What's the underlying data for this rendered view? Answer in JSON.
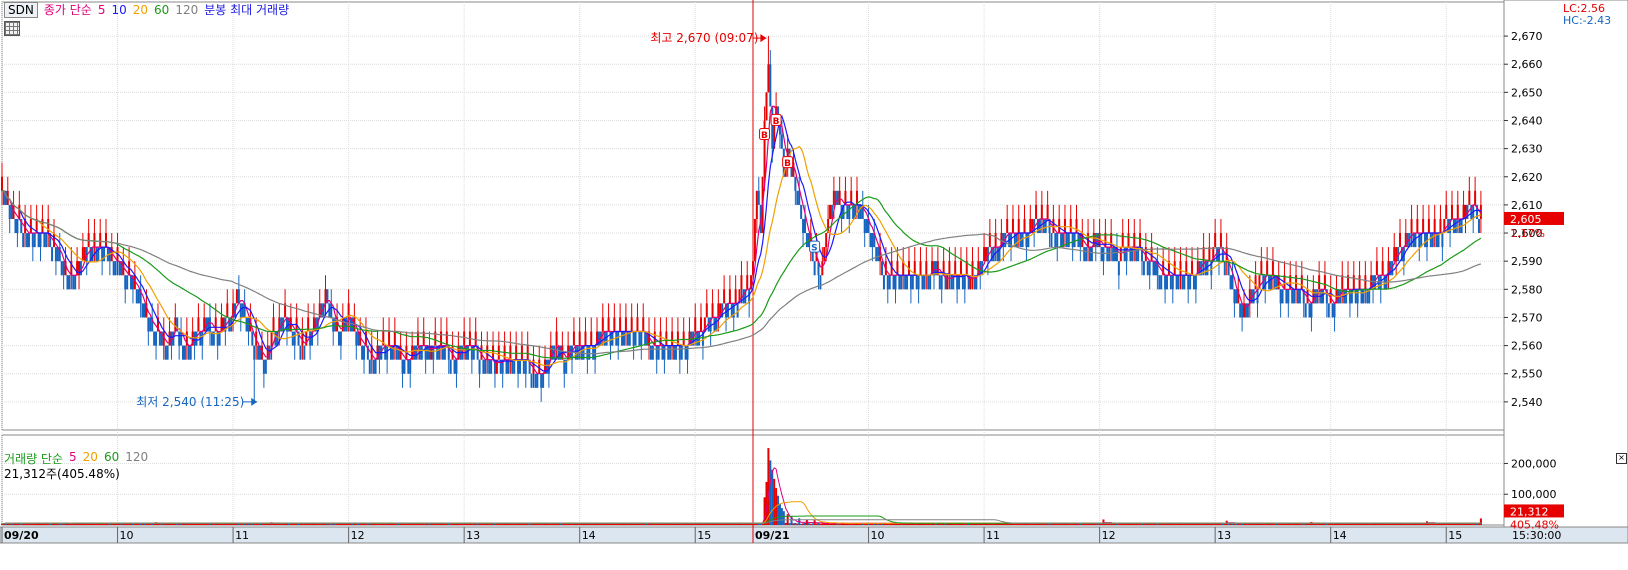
{
  "symbol": "SDN",
  "price_legend": {
    "label": "종가 단순",
    "periods": [
      "5",
      "10",
      "20",
      "60",
      "120"
    ],
    "extra": "분봉 최대 거래량"
  },
  "volume_legend": {
    "label": "거래량 단순",
    "periods": [
      "5",
      "20",
      "60",
      "120"
    ]
  },
  "volume_current": "21,312주(405.48%)",
  "lc_label": "LC:2.56",
  "hc_label": "HC:-2.43",
  "last_price_label": "2,605",
  "last_pct_label": "1.17%",
  "last_vol_label": "21,312",
  "last_vol_pct_label": "405.48%",
  "high_annotation": "최고 2,670 (09:07)",
  "low_annotation": "최저 2,540 (11:25)",
  "time_right_label": "15:30:00",
  "colors": {
    "up": "#e60000",
    "down": "#1565c0",
    "ma5": "#e0007a",
    "ma10": "#1a1aff",
    "ma20": "#f0a000",
    "ma60": "#1a9a1a",
    "ma120": "#808080",
    "grid": "#dcdcdc",
    "axis_bg": "#dce6f1"
  },
  "chart_data": [
    {
      "type": "candlestick",
      "title": "",
      "ylim": [
        2530,
        2675
      ],
      "y_ticks": [
        2540,
        2550,
        2560,
        2570,
        2580,
        2590,
        2600,
        2610,
        2620,
        2630,
        2640,
        2650,
        2660,
        2670
      ],
      "y_tick_labels": [
        "2,540",
        "2,550",
        "2,560",
        "2,570",
        "2,580",
        "2,590",
        "2,600",
        "2,610",
        "2,620",
        "2,630",
        "2,640",
        "2,650",
        "2,660",
        "2,670"
      ],
      "x_labels": [
        {
          "label": "09/20",
          "minute": 0,
          "bold": true
        },
        {
          "label": "10",
          "minute": 60
        },
        {
          "label": "11",
          "minute": 120
        },
        {
          "label": "12",
          "minute": 180
        },
        {
          "label": "13",
          "minute": 240
        },
        {
          "label": "14",
          "minute": 300
        },
        {
          "label": "15",
          "minute": 360
        },
        {
          "label": "09/21",
          "minute": 390,
          "bold": true
        },
        {
          "label": "10",
          "minute": 450
        },
        {
          "label": "11",
          "minute": 510
        },
        {
          "label": "12",
          "minute": 570
        },
        {
          "label": "13",
          "minute": 630
        },
        {
          "label": "14",
          "minute": 690
        },
        {
          "label": "15",
          "minute": 750
        }
      ],
      "total_minutes": 780,
      "session_break_minute": 390,
      "close_anchors": [
        [
          0,
          2615
        ],
        [
          6,
          2605
        ],
        [
          12,
          2600
        ],
        [
          20,
          2600
        ],
        [
          28,
          2595
        ],
        [
          34,
          2583
        ],
        [
          40,
          2588
        ],
        [
          46,
          2597
        ],
        [
          52,
          2595
        ],
        [
          58,
          2590
        ],
        [
          64,
          2585
        ],
        [
          70,
          2580
        ],
        [
          74,
          2570
        ],
        [
          80,
          2565
        ],
        [
          85,
          2560
        ],
        [
          90,
          2568
        ],
        [
          95,
          2558
        ],
        [
          100,
          2565
        ],
        [
          106,
          2568
        ],
        [
          112,
          2565
        ],
        [
          118,
          2570
        ],
        [
          122,
          2578
        ],
        [
          126,
          2572
        ],
        [
          130,
          2560
        ],
        [
          136,
          2555
        ],
        [
          141,
          2565
        ],
        [
          146,
          2570
        ],
        [
          151,
          2565
        ],
        [
          156,
          2560
        ],
        [
          162,
          2568
        ],
        [
          168,
          2578
        ],
        [
          174,
          2565
        ],
        [
          180,
          2570
        ],
        [
          186,
          2560
        ],
        [
          192,
          2555
        ],
        [
          198,
          2562
        ],
        [
          204,
          2558
        ],
        [
          210,
          2555
        ],
        [
          216,
          2560
        ],
        [
          222,
          2557
        ],
        [
          228,
          2560
        ],
        [
          234,
          2555
        ],
        [
          240,
          2560
        ],
        [
          248,
          2557
        ],
        [
          256,
          2552
        ],
        [
          262,
          2556
        ],
        [
          268,
          2555
        ],
        [
          274,
          2552
        ],
        [
          280,
          2550
        ],
        [
          286,
          2560
        ],
        [
          292,
          2556
        ],
        [
          298,
          2562
        ],
        [
          304,
          2560
        ],
        [
          310,
          2563
        ],
        [
          316,
          2565
        ],
        [
          322,
          2565
        ],
        [
          330,
          2563
        ],
        [
          338,
          2562
        ],
        [
          346,
          2560
        ],
        [
          354,
          2560
        ],
        [
          360,
          2565
        ],
        [
          366,
          2568
        ],
        [
          372,
          2572
        ],
        [
          378,
          2575
        ],
        [
          384,
          2578
        ],
        [
          388,
          2580
        ],
        [
          390,
          2590
        ],
        [
          392,
          2615
        ],
        [
          394,
          2600
        ],
        [
          396,
          2640
        ],
        [
          398,
          2660
        ],
        [
          400,
          2630
        ],
        [
          402,
          2645
        ],
        [
          404,
          2635
        ],
        [
          406,
          2620
        ],
        [
          408,
          2630
        ],
        [
          410,
          2620
        ],
        [
          414,
          2610
        ],
        [
          418,
          2598
        ],
        [
          422,
          2590
        ],
        [
          425,
          2583
        ],
        [
          428,
          2600
        ],
        [
          432,
          2615
        ],
        [
          436,
          2608
        ],
        [
          440,
          2612
        ],
        [
          444,
          2610
        ],
        [
          448,
          2605
        ],
        [
          452,
          2598
        ],
        [
          455,
          2590
        ],
        [
          460,
          2583
        ],
        [
          466,
          2585
        ],
        [
          472,
          2583
        ],
        [
          478,
          2586
        ],
        [
          484,
          2588
        ],
        [
          490,
          2582
        ],
        [
          496,
          2585
        ],
        [
          502,
          2582
        ],
        [
          508,
          2590
        ],
        [
          514,
          2595
        ],
        [
          520,
          2598
        ],
        [
          526,
          2600
        ],
        [
          532,
          2598
        ],
        [
          536,
          2605
        ],
        [
          540,
          2605
        ],
        [
          546,
          2600
        ],
        [
          550,
          2598
        ],
        [
          556,
          2600
        ],
        [
          562,
          2595
        ],
        [
          568,
          2598
        ],
        [
          574,
          2594
        ],
        [
          580,
          2592
        ],
        [
          586,
          2595
        ],
        [
          592,
          2592
        ],
        [
          598,
          2588
        ],
        [
          604,
          2585
        ],
        [
          610,
          2583
        ],
        [
          616,
          2585
        ],
        [
          622,
          2588
        ],
        [
          628,
          2592
        ],
        [
          632,
          2595
        ],
        [
          636,
          2588
        ],
        [
          640,
          2578
        ],
        [
          644,
          2572
        ],
        [
          648,
          2578
        ],
        [
          652,
          2582
        ],
        [
          656,
          2585
        ],
        [
          660,
          2583
        ],
        [
          666,
          2580
        ],
        [
          672,
          2578
        ],
        [
          678,
          2577
        ],
        [
          684,
          2578
        ],
        [
          690,
          2577
        ],
        [
          696,
          2578
        ],
        [
          702,
          2580
        ],
        [
          708,
          2582
        ],
        [
          714,
          2583
        ],
        [
          720,
          2588
        ],
        [
          726,
          2595
        ],
        [
          732,
          2600
        ],
        [
          738,
          2598
        ],
        [
          744,
          2600
        ],
        [
          750,
          2603
        ],
        [
          756,
          2605
        ],
        [
          760,
          2608
        ],
        [
          762,
          2612
        ],
        [
          765,
          2608
        ],
        [
          768,
          2605
        ]
      ],
      "high": {
        "value": 2670,
        "minute": 398
      },
      "low": {
        "value": 2540,
        "minute": 131
      },
      "last": {
        "value": 2605,
        "pct": 1.17
      },
      "ma_lines": [
        {
          "period": 5,
          "color_key": "ma5"
        },
        {
          "period": 10,
          "color_key": "ma10"
        },
        {
          "period": 20,
          "color_key": "ma20"
        },
        {
          "period": 60,
          "color_key": "ma60"
        },
        {
          "period": 120,
          "color_key": "ma120"
        }
      ],
      "signals": [
        {
          "minute": 396,
          "letter": "B"
        },
        {
          "minute": 402,
          "letter": "B"
        },
        {
          "minute": 408,
          "letter": "B"
        },
        {
          "minute": 422,
          "letter": "S"
        }
      ]
    },
    {
      "type": "bar",
      "title": "거래량",
      "ylim": [
        0,
        260000
      ],
      "y_ticks": [
        100000,
        200000
      ],
      "y_tick_labels": [
        "100,000",
        "200,000"
      ],
      "base_volume": 4000,
      "last_volume": 21312,
      "volume_spikes": [
        [
          396,
          90000
        ],
        [
          397,
          140000
        ],
        [
          398,
          250000
        ],
        [
          399,
          210000
        ],
        [
          400,
          180000
        ],
        [
          401,
          150000
        ],
        [
          402,
          120000
        ],
        [
          403,
          95000
        ],
        [
          404,
          70000
        ],
        [
          405,
          55000
        ],
        [
          406,
          45000
        ],
        [
          408,
          35000
        ],
        [
          410,
          28000
        ],
        [
          414,
          22000
        ],
        [
          418,
          18000
        ],
        [
          422,
          16000
        ],
        [
          80,
          9000
        ],
        [
          108,
          8000
        ],
        [
          140,
          9000
        ],
        [
          144,
          7000
        ],
        [
          176,
          8000
        ],
        [
          572,
          18000
        ],
        [
          636,
          14000
        ],
        [
          680,
          10000
        ],
        [
          740,
          12000
        ],
        [
          768,
          21312
        ]
      ]
    }
  ]
}
